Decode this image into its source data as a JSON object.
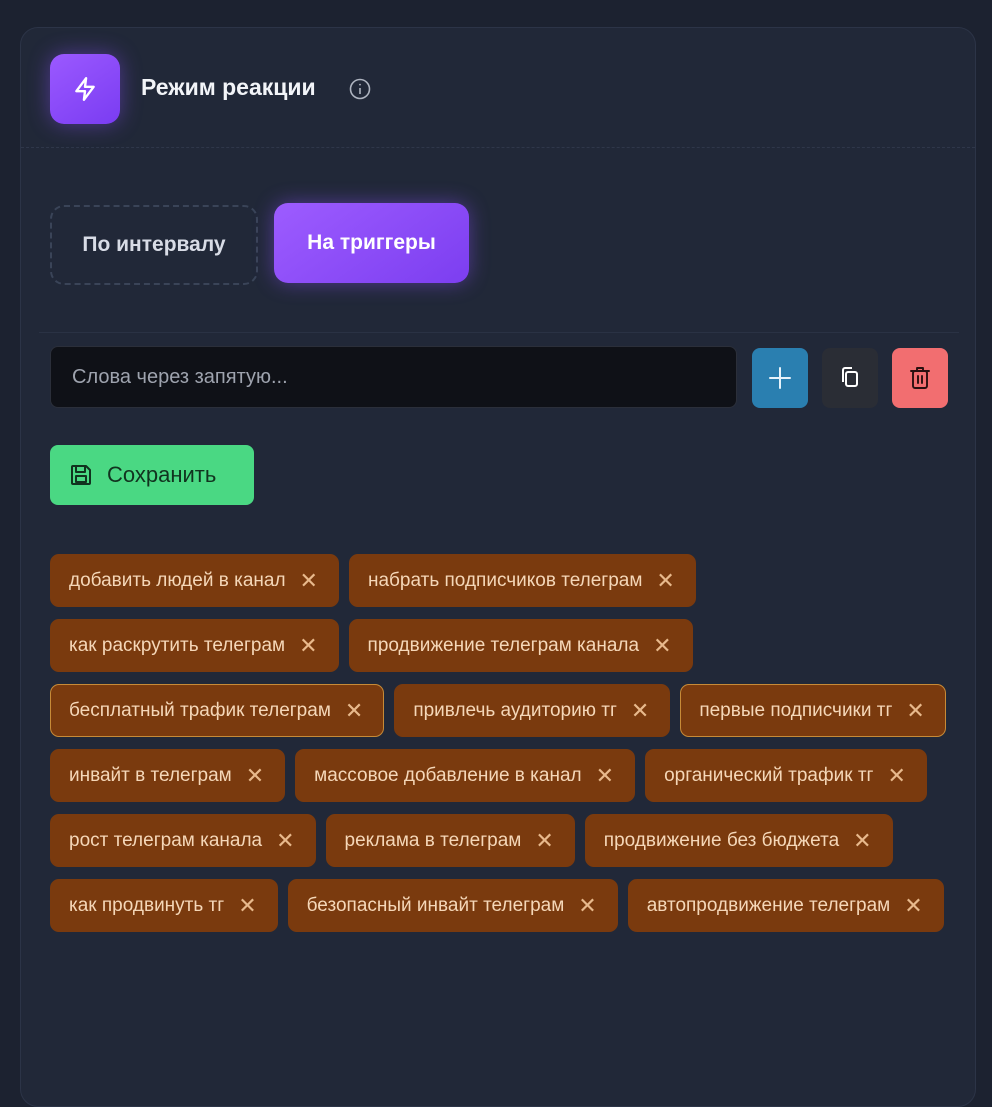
{
  "header": {
    "title": "Режим реакции",
    "icon": "lightning-icon"
  },
  "mode": {
    "options": [
      {
        "label": "По интервалу",
        "active": false
      },
      {
        "label": "На триггеры",
        "active": true
      }
    ]
  },
  "input": {
    "placeholder": "Слова через запятую...",
    "value": ""
  },
  "actions": {
    "add_icon": "plus-icon",
    "copy_icon": "copy-icon",
    "delete_icon": "trash-icon"
  },
  "save": {
    "label": "Сохранить",
    "icon": "floppy-disk-icon"
  },
  "tags": [
    {
      "label": "добавить людей в канал",
      "highlight": false
    },
    {
      "label": "набрать подписчиков телеграм",
      "highlight": false
    },
    {
      "label": "как раскрутить телеграм",
      "highlight": false
    },
    {
      "label": "продвижение телеграм канала",
      "highlight": false
    },
    {
      "label": "бесплатный трафик телеграм",
      "highlight": true
    },
    {
      "label": "привлечь аудиторию тг",
      "highlight": false
    },
    {
      "label": "первые подписчики тг",
      "highlight": true
    },
    {
      "label": "инвайт в телеграм",
      "highlight": false
    },
    {
      "label": "массовое добавление в канал",
      "highlight": false
    },
    {
      "label": "органический трафик тг",
      "highlight": false
    },
    {
      "label": "рост телеграм канала",
      "highlight": false
    },
    {
      "label": "реклама в телеграм",
      "highlight": false
    },
    {
      "label": "продвижение без бюджета",
      "highlight": false
    },
    {
      "label": "как продвинуть тг",
      "highlight": false
    },
    {
      "label": "безопасный инвайт телеграм",
      "highlight": false
    },
    {
      "label": "автопродвижение телеграм",
      "highlight": false
    }
  ],
  "tag_remove_symbol": "✕",
  "colors": {
    "accent_purple": "#8b4cff",
    "add_button": "#2a7fb0",
    "delete_button": "#f26e70",
    "save_button": "#4ad883",
    "tag_background": "#7a3a0e"
  }
}
